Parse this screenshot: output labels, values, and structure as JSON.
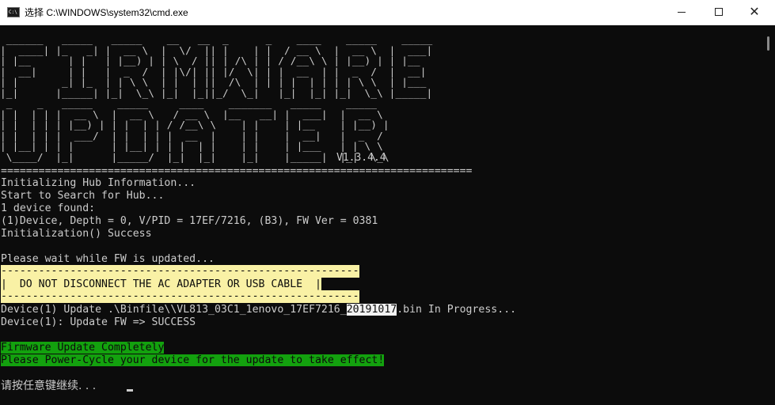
{
  "window": {
    "title": "选择 C:\\WINDOWS\\system32\\cmd.exe",
    "icon": "cmd-icon",
    "icon_text": "C:\\",
    "controls": {
      "minimize": "minimize-icon",
      "maximize": "maximize-icon",
      "close": "close-icon",
      "close_glyph": "✕"
    }
  },
  "console": {
    "banner_art": " ______   _____   _____    __   __  _      _    ____    _____    _____\n|  ____| |_   _| |  __ \\  |  \\/  || |    | |  / __ \\  |  __ \\  |  ___|\n| |__      | |   | |__) | | \\  / || | /\\ | | / /__\\ \\ | |__) | | |__\n|  __|     | |   |  _  /  | |\\/| || |/  \\| | |  __  | |  _  /  |  __|\n| |       _| |_  | | \\ \\  | |  | ||  /\\  | | | |  | | | | \\ \\  | |___\n|_|      |_____| |_|  \\_\\ |_|  |_||_/  \\_|   |_|  |_| |_|  \\_\\ |_____|\n _    _   _____    _____     ____    _______   _____    _____\n| |  | | |  __ \\  |  __ \\   / __ \\  |__   __| |  ___|  |  __ \\\n| |  | | | |__) | | |  | | / /__\\ \\    | |    | |__    | |__) |\n| |  | | |  ___/  | |  | | |  __  |    | |    |  __|   |  _  /\n| |__| | | |      | |__| | | |  | |    | |    | |___   | | \\ \\\n \\____/  |_|      |_____/  |_|  |_|    |_|    |_____|  |_|  \\_\\",
    "version": "V1.3.4.4",
    "separator": "===========================================================================",
    "lines": {
      "initializing": "Initializing Hub Information...",
      "searching": "Start to Search for Hub...",
      "found": "1 device found:",
      "device_info": "(1)Device, Depth = 0, V/PID = 17EF/7216, (B3), FW Ver = 0381",
      "init_success": "Initialization() Success",
      "please_wait": "Please wait while FW is updated...",
      "update_prefix": "Device(1) Update .\\Binfile\\\\VL813_03C1_1enovo_17EF7216_",
      "update_selected": "20191017",
      "update_suffix": ".bin In Progress...",
      "fw_success": "Device(1): Update FW => SUCCESS",
      "update_complete": "Firmware Update Completely",
      "power_cycle": "Please Power-Cycle your device for the update to take effect!",
      "prompt": "请按任意键继续. . . "
    },
    "warning": {
      "border": "---------------------------------------------------------",
      "message": "|  DO NOT DISCONNECT THE AC ADAPTER OR USB CABLE  |"
    }
  },
  "colors": {
    "console_bg": "#0c0c0c",
    "console_fg": "#cccccc",
    "warning_bg": "#f9f1a5",
    "success_bg": "#13a10e",
    "selection_bg": "#f2f2f2"
  }
}
